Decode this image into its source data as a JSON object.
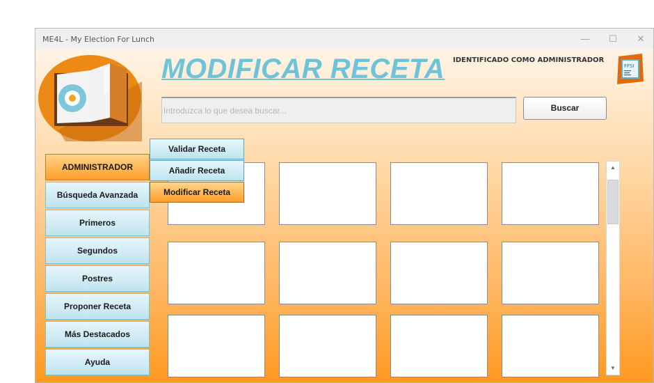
{
  "window": {
    "title": "ME4L - My Election For Lunch",
    "controls": {
      "minimize": "—",
      "maximize": "☐",
      "close": "✕"
    }
  },
  "header": {
    "page_title": "MODIFICAR RECETA",
    "user_status": "IDENTIFICADO COMO ADMINISTRADOR",
    "badge_text": "FFSI"
  },
  "search": {
    "placeholder": "Introduzca lo que desea buscar...",
    "value": "",
    "button_label": "Buscar"
  },
  "sidebar": {
    "items": [
      {
        "label": "ADMINISTRADOR",
        "active": true
      },
      {
        "label": "Búsqueda Avanzada",
        "active": false
      },
      {
        "label": "Primeros",
        "active": false
      },
      {
        "label": "Segundos",
        "active": false
      },
      {
        "label": "Postres",
        "active": false
      },
      {
        "label": "Proponer Receta",
        "active": false
      },
      {
        "label": "Más Destacados",
        "active": false
      },
      {
        "label": "Ayuda",
        "active": false
      }
    ]
  },
  "admin_menu": {
    "items": [
      {
        "label": "Validar Receta",
        "active": false
      },
      {
        "label": "Añadir Receta",
        "active": false
      },
      {
        "label": "Modificar Receta",
        "active": true
      }
    ]
  },
  "colors": {
    "title_accent": "#6ec3d8",
    "active_item": "#ff9e2a",
    "sidebar_item": "#bfe4ef",
    "background_bottom": "#ff9a1f"
  },
  "icons": {
    "logo": "open-book-logo-icon",
    "badge": "ffsi-badge-icon",
    "scroll_up": "scroll-up-arrow-icon",
    "scroll_down": "scroll-down-arrow-icon"
  }
}
